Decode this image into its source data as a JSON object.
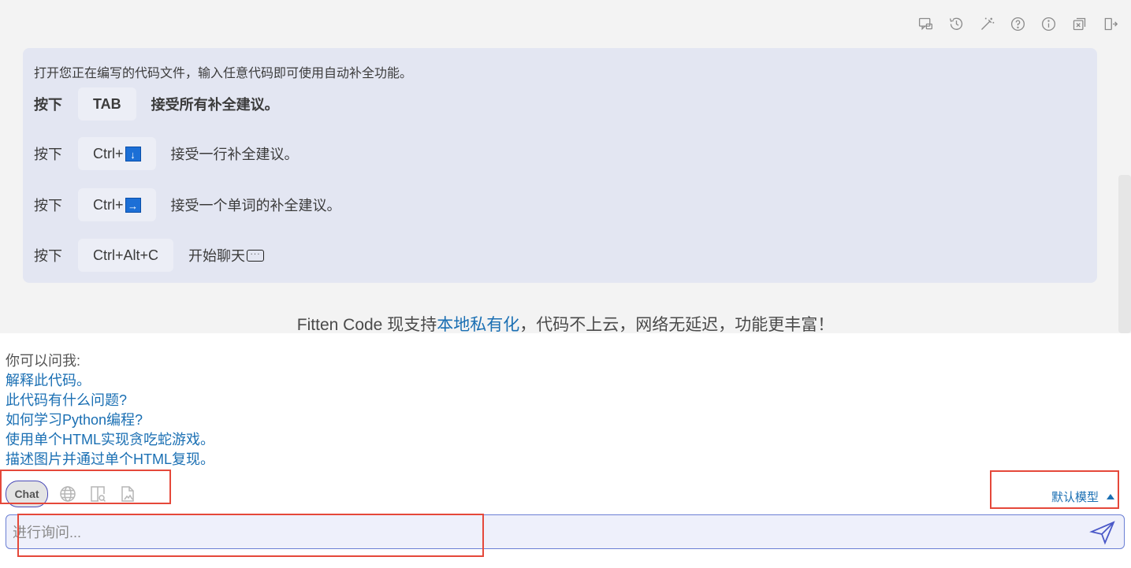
{
  "toolbar": {
    "icons": [
      "new-chat-icon",
      "history-icon",
      "magic-wand-icon",
      "help-icon",
      "info-icon",
      "close-file-icon",
      "logout-icon"
    ]
  },
  "card": {
    "intro": "打开您正在编写的代码文件，输入任意代码即可使用自动补全功能。",
    "rows": [
      {
        "pre": "按下",
        "key": "TAB",
        "desc": "接受所有补全建议。"
      },
      {
        "pre": "按下",
        "key": "Ctrl+",
        "desc": "接受一行补全建议。"
      },
      {
        "pre": "按下",
        "key": "Ctrl+",
        "desc": "接受一个单词的补全建议。"
      },
      {
        "pre": "按下",
        "key": "Ctrl+Alt+C",
        "desc": "开始聊天"
      }
    ]
  },
  "promo": {
    "before": "Fitten Code 现支持",
    "link": "本地私有化",
    "after": "，代码不上云，网络无延迟，功能更丰富！"
  },
  "suggestions": {
    "label": "你可以问我:",
    "items": [
      "解释此代码。",
      "此代码有什么问题?",
      "如何学习Python编程?",
      "使用单个HTML实现贪吃蛇游戏。",
      "描述图片并通过单个HTML复现。"
    ]
  },
  "tools": {
    "chat_label": "Chat",
    "icons": [
      "globe-icon",
      "file-search-icon",
      "image-file-icon"
    ]
  },
  "model": {
    "label": "默认模型"
  },
  "input": {
    "placeholder": "进行询问..."
  },
  "colors": {
    "accent": "#1a6fb3",
    "card_bg": "#e3e6f2",
    "highlight": "#e5483a",
    "send": "#4a58c8"
  }
}
